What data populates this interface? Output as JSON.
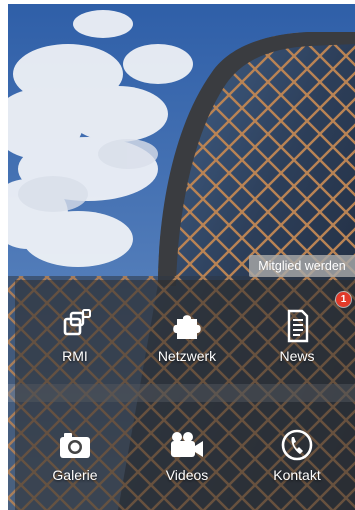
{
  "header": {
    "join_label": "Mitglied werden"
  },
  "menu": {
    "items": [
      {
        "id": "rmi",
        "label": "RMI",
        "icon": "overlapping-squares-icon"
      },
      {
        "id": "netzwerk",
        "label": "Netzwerk",
        "icon": "puzzle-piece-icon"
      },
      {
        "id": "news",
        "label": "News",
        "icon": "document-icon",
        "badge": "1"
      },
      {
        "id": "galerie",
        "label": "Galerie",
        "icon": "camera-icon"
      },
      {
        "id": "videos",
        "label": "Videos",
        "icon": "video-camera-icon"
      },
      {
        "id": "kontakt",
        "label": "Kontakt",
        "icon": "phone-icon"
      }
    ]
  },
  "colors": {
    "sky": "#3f6fb0",
    "badge": "#e23a2a",
    "lattice": "#b07a4e"
  }
}
